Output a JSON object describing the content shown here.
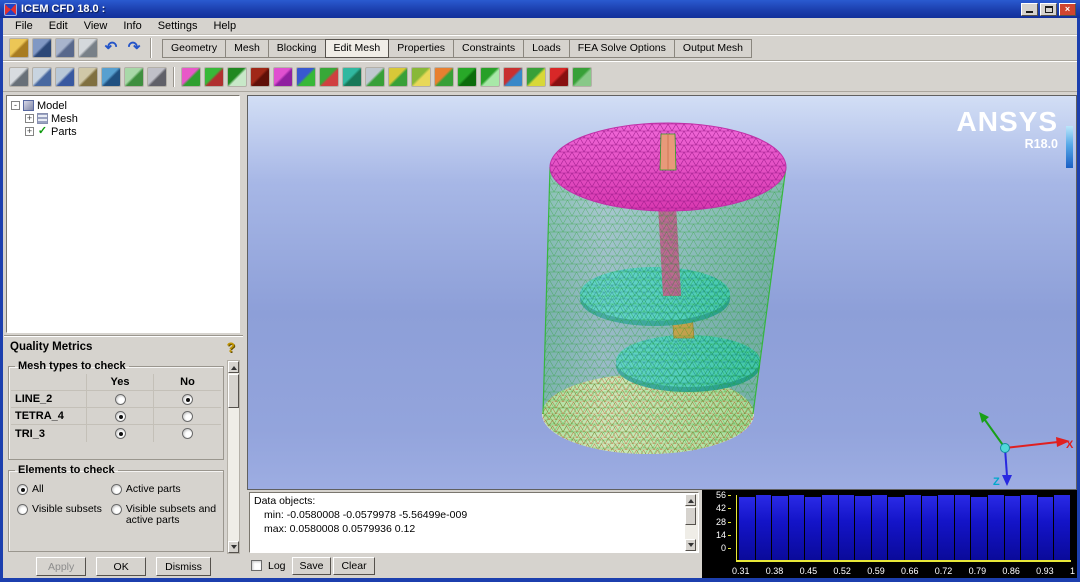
{
  "window": {
    "title": "ICEM CFD 18.0 :",
    "close_glyph": "×"
  },
  "icons": {
    "help_glyph": "?",
    "parts_check_glyph": "✓"
  },
  "menu": {
    "items": [
      "File",
      "Edit",
      "View",
      "Info",
      "Settings",
      "Help"
    ]
  },
  "toolbar_tabs": {
    "items": [
      "Geometry",
      "Mesh",
      "Blocking",
      "Edit Mesh",
      "Properties",
      "Constraints",
      "Loads",
      "FEA Solve Options",
      "Output Mesh"
    ],
    "active": "Edit Mesh"
  },
  "toolbar_row1_icons": [
    {
      "name": "open-file-icon",
      "c1": "#ecc656",
      "c2": "#a87c20"
    },
    {
      "name": "save-icon",
      "c1": "#8098c4",
      "c2": "#2c4878"
    },
    {
      "name": "save-project-icon",
      "c1": "#a8b4cc",
      "c2": "#58688c"
    },
    {
      "name": "screenshot-icon",
      "c1": "#d4d8dc",
      "c2": "#788088"
    },
    {
      "name": "undo-icon",
      "glyph": "↶",
      "color": "#2454c8"
    },
    {
      "name": "redo-icon",
      "glyph": "↷",
      "color": "#2454c8"
    }
  ],
  "toolbar_row2_view_icons": [
    {
      "name": "zoom-in-icon",
      "c1": "#d8dce0",
      "c2": "#687078"
    },
    {
      "name": "zoom-window-icon",
      "c1": "#c8d4e0",
      "c2": "#4868a0"
    },
    {
      "name": "fit-window-icon",
      "c1": "#b8c8d8",
      "c2": "#3858a0"
    },
    {
      "name": "measure-distance-icon",
      "c1": "#d0c8a8",
      "c2": "#807040"
    },
    {
      "name": "screen-split-icon",
      "c1": "#58a0d0",
      "c2": "#205080"
    },
    {
      "name": "screen-layout-icon",
      "c1": "#a8d8a8",
      "c2": "#3f8f3f"
    },
    {
      "name": "display-options-icon",
      "c1": "#c0c0c8",
      "c2": "#606068"
    }
  ],
  "toolbar_row2_tool_icons": [
    {
      "name": "create-elements-icon",
      "c1": "#e858c8",
      "c2": "#30a030"
    },
    {
      "name": "extrude-mesh-icon",
      "c1": "#38b838",
      "c2": "#b03030"
    },
    {
      "name": "check-mesh-icon",
      "c1": "#208820",
      "c2": "#c8e8c8"
    },
    {
      "name": "display-mesh-quality-icon",
      "c1": "#a02818",
      "c2": "#601008"
    },
    {
      "name": "smooth-mesh-icon",
      "c1": "#e050d0",
      "c2": "#9020a0"
    },
    {
      "name": "repair-mesh-icon",
      "c1": "#3858d0",
      "c2": "#38b838"
    },
    {
      "name": "merge-nodes-icon",
      "c1": "#38a838",
      "c2": "#d04040"
    },
    {
      "name": "split-mesh-icon",
      "c1": "#30b8a0",
      "c2": "#187858"
    },
    {
      "name": "move-nodes-icon",
      "c1": "#c0c8d0",
      "c2": "#38a038"
    },
    {
      "name": "project-nodes-icon",
      "c1": "#d8c838",
      "c2": "#38a038"
    },
    {
      "name": "edit-mesh-pencil-icon",
      "c1": "#88b838",
      "c2": "#e8d858"
    },
    {
      "name": "transform-mesh-icon",
      "c1": "#e88030",
      "c2": "#38a038"
    },
    {
      "name": "adjust-mesh-density-icon",
      "c1": "#28a828",
      "c2": "#0c6c0c"
    },
    {
      "name": "renumber-mesh-icon",
      "c1": "#28a028",
      "c2": "#a8e8a8"
    },
    {
      "name": "repair-tools-icon",
      "c1": "#c83030",
      "c2": "#3888c8"
    },
    {
      "name": "split-edge-icon",
      "c1": "#38a038",
      "c2": "#d8d838"
    },
    {
      "name": "delete-elements-icon",
      "c1": "#d82828",
      "c2": "#881010"
    },
    {
      "name": "merge-meshes-icon",
      "c1": "#38a038",
      "c2": "#88c888"
    }
  ],
  "tree": {
    "rows": [
      {
        "label": "Model",
        "level": 0,
        "expander": "-",
        "icon": "model-icon"
      },
      {
        "label": "Mesh",
        "level": 1,
        "expander": "+",
        "icon": "mesh-icon"
      },
      {
        "label": "Parts",
        "level": 1,
        "expander": "+",
        "icon": "parts-icon"
      }
    ]
  },
  "quality_panel": {
    "title": "Quality Metrics",
    "mesh_types": {
      "legend": "Mesh types to check",
      "columns": [
        "Yes",
        "No"
      ],
      "rows": [
        {
          "label": "LINE_2",
          "yes": false,
          "no": true
        },
        {
          "label": "TETRA_4",
          "yes": true,
          "no": false
        },
        {
          "label": "TRI_3",
          "yes": true,
          "no": false
        }
      ]
    },
    "elements": {
      "legend": "Elements to check",
      "options": [
        {
          "label": "All",
          "selected": true
        },
        {
          "label": "Active parts",
          "selected": false
        },
        {
          "label": "Visible subsets",
          "selected": false
        },
        {
          "label": "Visible subsets and active parts",
          "selected": false
        }
      ]
    },
    "buttons": [
      {
        "label": "Apply",
        "disabled": true
      },
      {
        "label": "OK",
        "disabled": false
      },
      {
        "label": "Dismiss",
        "disabled": false
      }
    ]
  },
  "viewport": {
    "brand": "ANSYS",
    "version": "R18.0",
    "triad": {
      "x_label": "X",
      "z_label": "Z"
    }
  },
  "message_log": {
    "lines": [
      {
        "text": "Data objects:",
        "indent": 0
      },
      {
        "text": "min: -0.0580008 -0.0579978 -5.56499e-009",
        "indent": 1
      },
      {
        "text": "max: 0.0580008 0.0579936 0.12",
        "indent": 1
      }
    ],
    "log_checkbox": {
      "label": "Log",
      "checked": false
    },
    "buttons": [
      "Save",
      "Clear"
    ]
  },
  "chart_data": {
    "type": "bar",
    "title": "",
    "xlabel": "",
    "ylabel": "",
    "x_range": [
      0.31,
      1.0
    ],
    "bin_labels": [
      "0.31",
      "0.38",
      "0.45",
      "0.52",
      "0.59",
      "0.66",
      "0.72",
      "0.79",
      "0.86",
      "0.93",
      "1"
    ],
    "yticks": [
      0,
      14,
      28,
      42,
      56
    ],
    "ylim": [
      0,
      56
    ],
    "values": [
      54,
      56,
      55,
      56,
      54,
      56,
      56,
      55,
      56,
      54,
      56,
      55,
      56,
      56,
      54,
      56,
      55,
      56,
      54,
      56
    ],
    "bar_color": "#1414c8",
    "axis_color": "#e8e838",
    "background": "#000000",
    "legend": "off",
    "grid": "off"
  }
}
